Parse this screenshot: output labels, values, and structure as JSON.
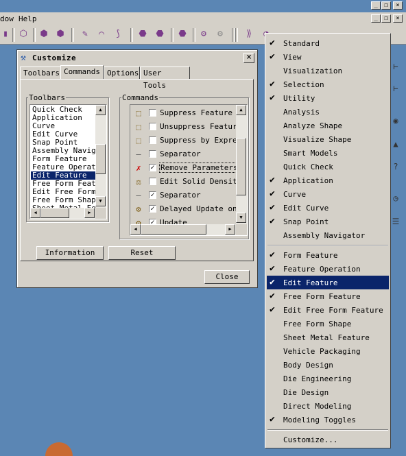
{
  "menubar": {
    "window_label": "dow",
    "help_label": "Help"
  },
  "window_controls": {
    "minimize": "_",
    "restore": "❐",
    "close": "×"
  },
  "dialog": {
    "title": "Customize",
    "close_label": "×",
    "tabs": [
      {
        "label": "Toolbars",
        "active": false
      },
      {
        "label": "Commands",
        "active": true
      },
      {
        "label": "Options",
        "active": false
      },
      {
        "label": "User Tools",
        "active": false
      }
    ],
    "toolbars_group_label": "Toolbars",
    "toolbars_list": [
      {
        "label": "Quick Check",
        "selected": false
      },
      {
        "label": "Application",
        "selected": false
      },
      {
        "label": "Curve",
        "selected": false
      },
      {
        "label": "Edit Curve",
        "selected": false
      },
      {
        "label": "Snap Point",
        "selected": false
      },
      {
        "label": "Assembly Navigat",
        "selected": false
      },
      {
        "label": "Form Feature",
        "selected": false
      },
      {
        "label": "Feature Operati",
        "selected": false
      },
      {
        "label": "Edit Feature",
        "selected": true
      },
      {
        "label": "Free Form Featu",
        "selected": false
      },
      {
        "label": "Edit Free Form F",
        "selected": false
      },
      {
        "label": "Free Form Shape",
        "selected": false
      },
      {
        "label": "Sheet Metal Fea",
        "selected": false
      }
    ],
    "commands_group_label": "Commands",
    "commands_list": [
      {
        "label": "Suppress Feature",
        "checked": false,
        "icon": "suppress-icon",
        "glyph": "⬚"
      },
      {
        "label": "Unsuppress Feature",
        "checked": false,
        "icon": "unsuppress-icon",
        "glyph": "⬚"
      },
      {
        "label": "Suppress by Expres",
        "checked": false,
        "icon": "suppress-expr-icon",
        "glyph": "⬚"
      },
      {
        "label": "Separator",
        "checked": false,
        "icon": "separator-icon",
        "glyph": "—"
      },
      {
        "label": "Remove Parameters",
        "checked": true,
        "icon": "remove-params-icon",
        "glyph": "✗"
      },
      {
        "label": "Edit Solid Density",
        "checked": false,
        "icon": "density-icon",
        "glyph": "⚖"
      },
      {
        "label": "Separator",
        "checked": true,
        "icon": "separator-icon",
        "glyph": "—"
      },
      {
        "label": "Delayed Update on",
        "checked": true,
        "icon": "delayed-update-icon",
        "glyph": "⚙"
      },
      {
        "label": "Update",
        "checked": true,
        "icon": "update-icon",
        "glyph": "⚙"
      }
    ],
    "information_button": "Information",
    "reset_button": "Reset",
    "close_button": "Close"
  },
  "context_menu": {
    "items": [
      {
        "label": "Standard",
        "checked": true
      },
      {
        "label": "View",
        "checked": true
      },
      {
        "label": "Visualization",
        "checked": false
      },
      {
        "label": "Selection",
        "checked": true
      },
      {
        "label": "Utility",
        "checked": true
      },
      {
        "label": "Analysis",
        "checked": false
      },
      {
        "label": "Analyze Shape",
        "checked": false
      },
      {
        "label": "Visualize Shape",
        "checked": false
      },
      {
        "label": "Smart Models",
        "checked": false
      },
      {
        "label": "Quick Check",
        "checked": false
      },
      {
        "label": "Application",
        "checked": true
      },
      {
        "label": "Curve",
        "checked": true
      },
      {
        "label": "Edit Curve",
        "checked": true
      },
      {
        "label": "Snap Point",
        "checked": true
      },
      {
        "label": "Assembly Navigator",
        "checked": false
      },
      {
        "label": "Form Feature",
        "checked": true
      },
      {
        "label": "Feature Operation",
        "checked": true
      },
      {
        "label": "Edit Feature",
        "checked": true,
        "highlighted": true
      },
      {
        "label": "Free Form Feature",
        "checked": true
      },
      {
        "label": "Edit Free Form Feature",
        "checked": true
      },
      {
        "label": "Free Form Shape",
        "checked": false
      },
      {
        "label": "Sheet Metal Feature",
        "checked": false
      },
      {
        "label": "Vehicle Packaging",
        "checked": false
      },
      {
        "label": "Body Design",
        "checked": false
      },
      {
        "label": "Die Engineering",
        "checked": false
      },
      {
        "label": "Die Design",
        "checked": false
      },
      {
        "label": "Direct Modeling",
        "checked": false
      },
      {
        "label": "Modeling Toggles",
        "checked": true
      }
    ],
    "customize_label": "Customize...",
    "check_glyph": "✔"
  },
  "toolbar_icons": [
    "layer-icon",
    "select-icon",
    "assembly-icon",
    "assembly2-icon",
    "sketch-icon",
    "curve-icon",
    "fillet-curve-icon",
    "feature-icon",
    "feature2-icon",
    "update-icon",
    "component-icon",
    "component2-icon",
    "extrude-icon",
    "blend-icon",
    "surface-icon",
    "surface2-icon",
    "grid-icon",
    "measure-icon",
    "triangle-icon"
  ]
}
